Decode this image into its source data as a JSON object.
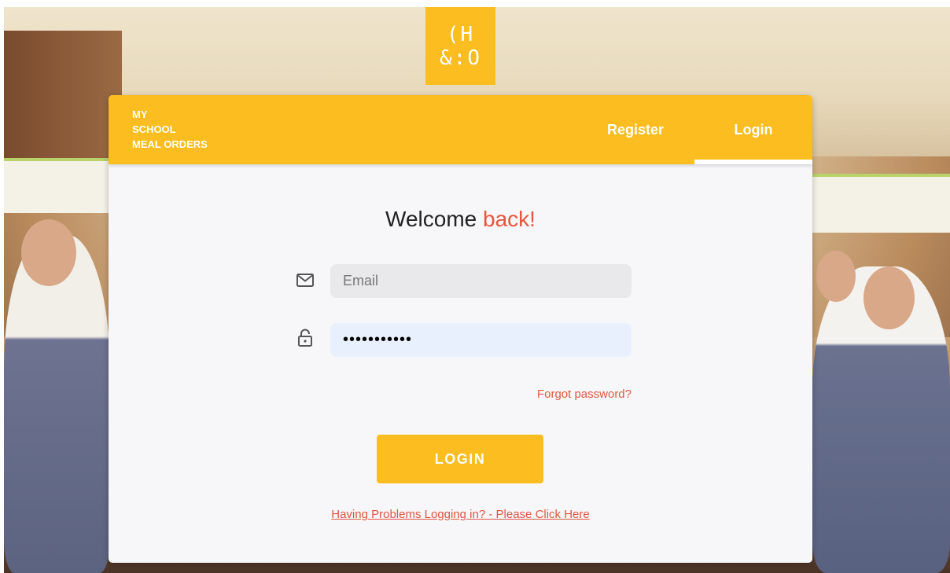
{
  "logo": {
    "line1": "(H",
    "line2": "&:O"
  },
  "header": {
    "brand": "MY\nSCHOOL\nMEAL ORDERS",
    "tabs": [
      {
        "label": "Register",
        "active": false
      },
      {
        "label": "Login",
        "active": true
      }
    ]
  },
  "form": {
    "welcome": "Welcome",
    "welcome_accent": "back!",
    "email": {
      "placeholder": "Email",
      "value": "",
      "icon": "mail-icon"
    },
    "password": {
      "value": "•••••••••••",
      "icon": "lock-icon"
    },
    "forgot_label": "Forgot password?",
    "login_label": "LOGIN",
    "help_link": "Having Problems Logging in? - Please Click Here"
  },
  "colors": {
    "brand_yellow": "#fbbd1f",
    "accent_red": "#e8553d",
    "card_bg": "#f7f7f9"
  }
}
